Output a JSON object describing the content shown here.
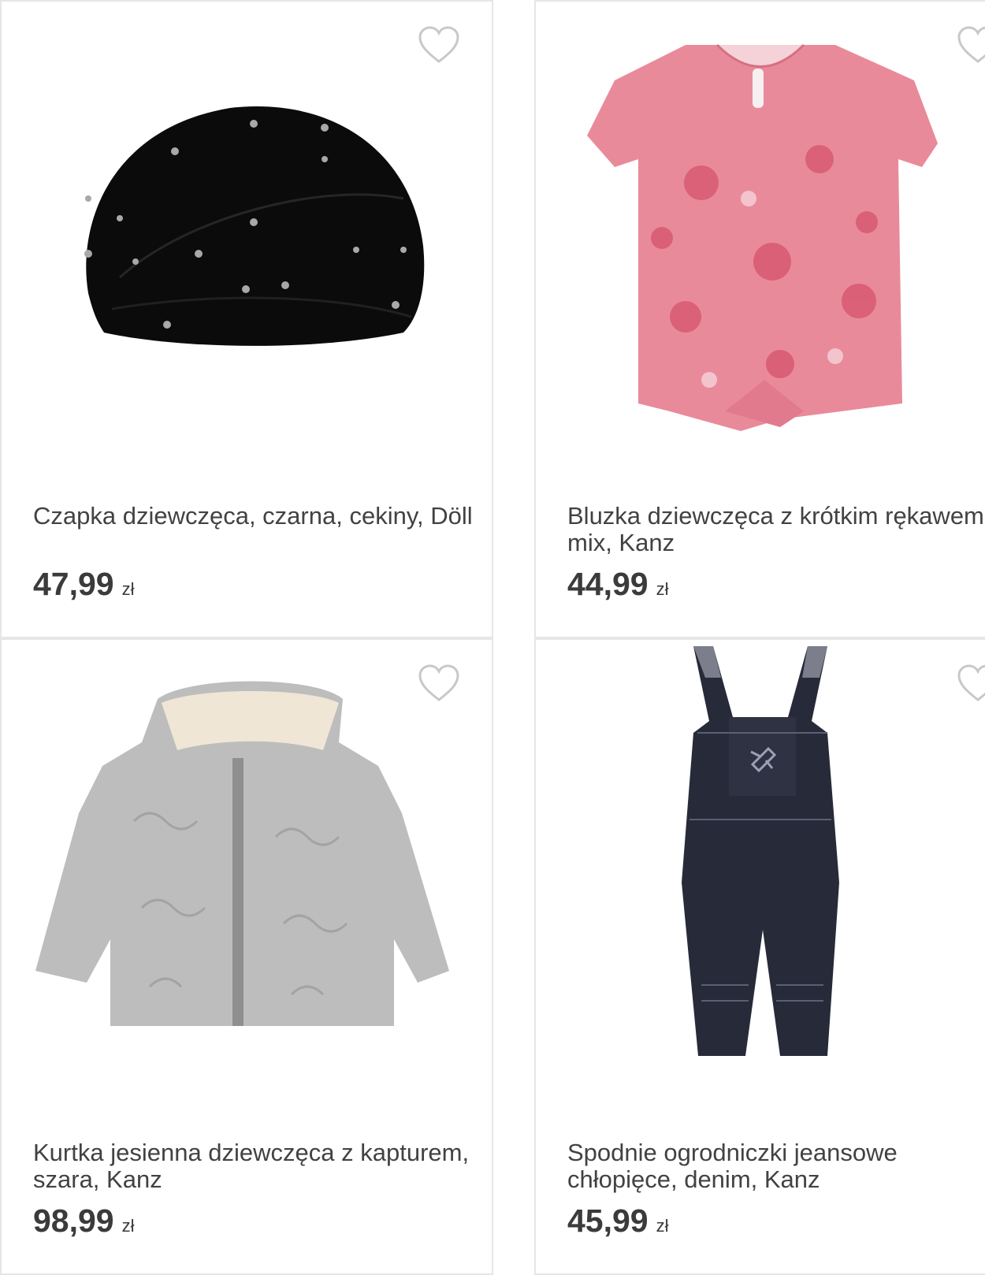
{
  "products": [
    {
      "title": "Czapka dziewczęca, czarna, cekiny, Döll",
      "price": "47,99",
      "currency": "zł",
      "image_icon": "beanie-hat-image",
      "wishlist_icon": "heart-icon"
    },
    {
      "title": "Bluzka dziewczęca z krótkim rękawem, mix, Kanz",
      "price": "44,99",
      "currency": "zł",
      "image_icon": "pink-blouse-image",
      "wishlist_icon": "heart-icon"
    },
    {
      "title": "Kurtka jesienna dziewczęca z kapturem, szara, Kanz",
      "price": "98,99",
      "currency": "zł",
      "image_icon": "grey-jacket-image",
      "wishlist_icon": "heart-icon"
    },
    {
      "title": "Spodnie ogrodniczki jeansowe chłopięce, denim, Kanz",
      "price": "45,99",
      "currency": "zł",
      "image_icon": "denim-overalls-image",
      "wishlist_icon": "heart-icon"
    }
  ],
  "colors": {
    "text": "#424242",
    "price": "#3b3b3b",
    "border": "#e6e6e6",
    "heart": "#c8c8c8"
  }
}
